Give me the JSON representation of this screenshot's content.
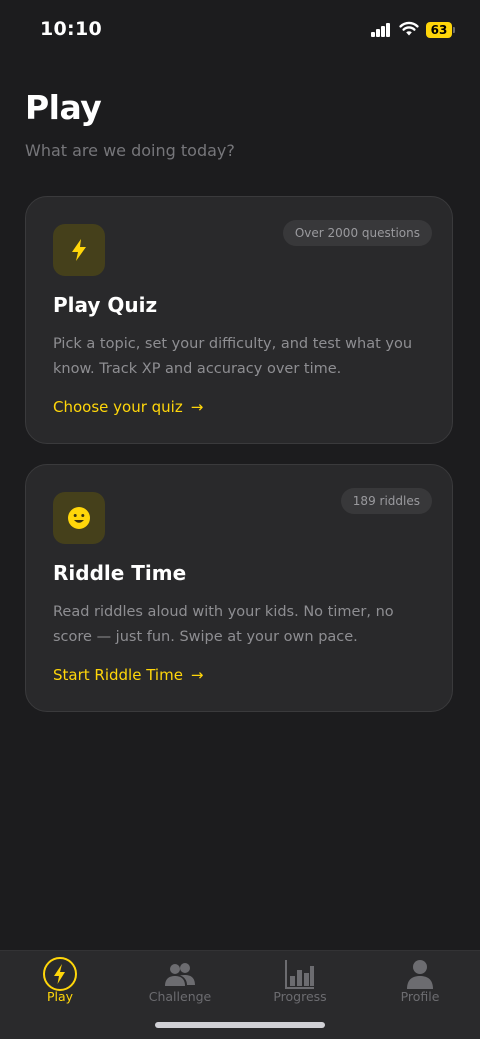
{
  "status_bar": {
    "time": "10:10",
    "battery_level": "63"
  },
  "header": {
    "title": "Play",
    "subtitle": "What are we doing today?"
  },
  "cards": [
    {
      "icon": "lightning-bolt-icon",
      "badge": "Over 2000 questions",
      "title": "Play Quiz",
      "description": "Pick a topic, set your difficulty, and test what you know. Track XP and accuracy over time.",
      "link": "Choose your quiz"
    },
    {
      "icon": "smiley-face-icon",
      "badge": "189 riddles",
      "title": "Riddle Time",
      "description": "Read riddles aloud with your kids. No timer, no score — just fun. Swipe at your own pace.",
      "link": "Start Riddle Time"
    }
  ],
  "tab_bar": {
    "active": "Play",
    "tabs": [
      {
        "label": "Play",
        "icon": "lightning-bolt-icon"
      },
      {
        "label": "Challenge",
        "icon": "people-icon"
      },
      {
        "label": "Progress",
        "icon": "bar-chart-icon"
      },
      {
        "label": "Profile",
        "icon": "person-icon"
      }
    ]
  },
  "colors": {
    "accent": "#ffd60a",
    "background": "#1c1c1e",
    "card": "#29292b"
  }
}
